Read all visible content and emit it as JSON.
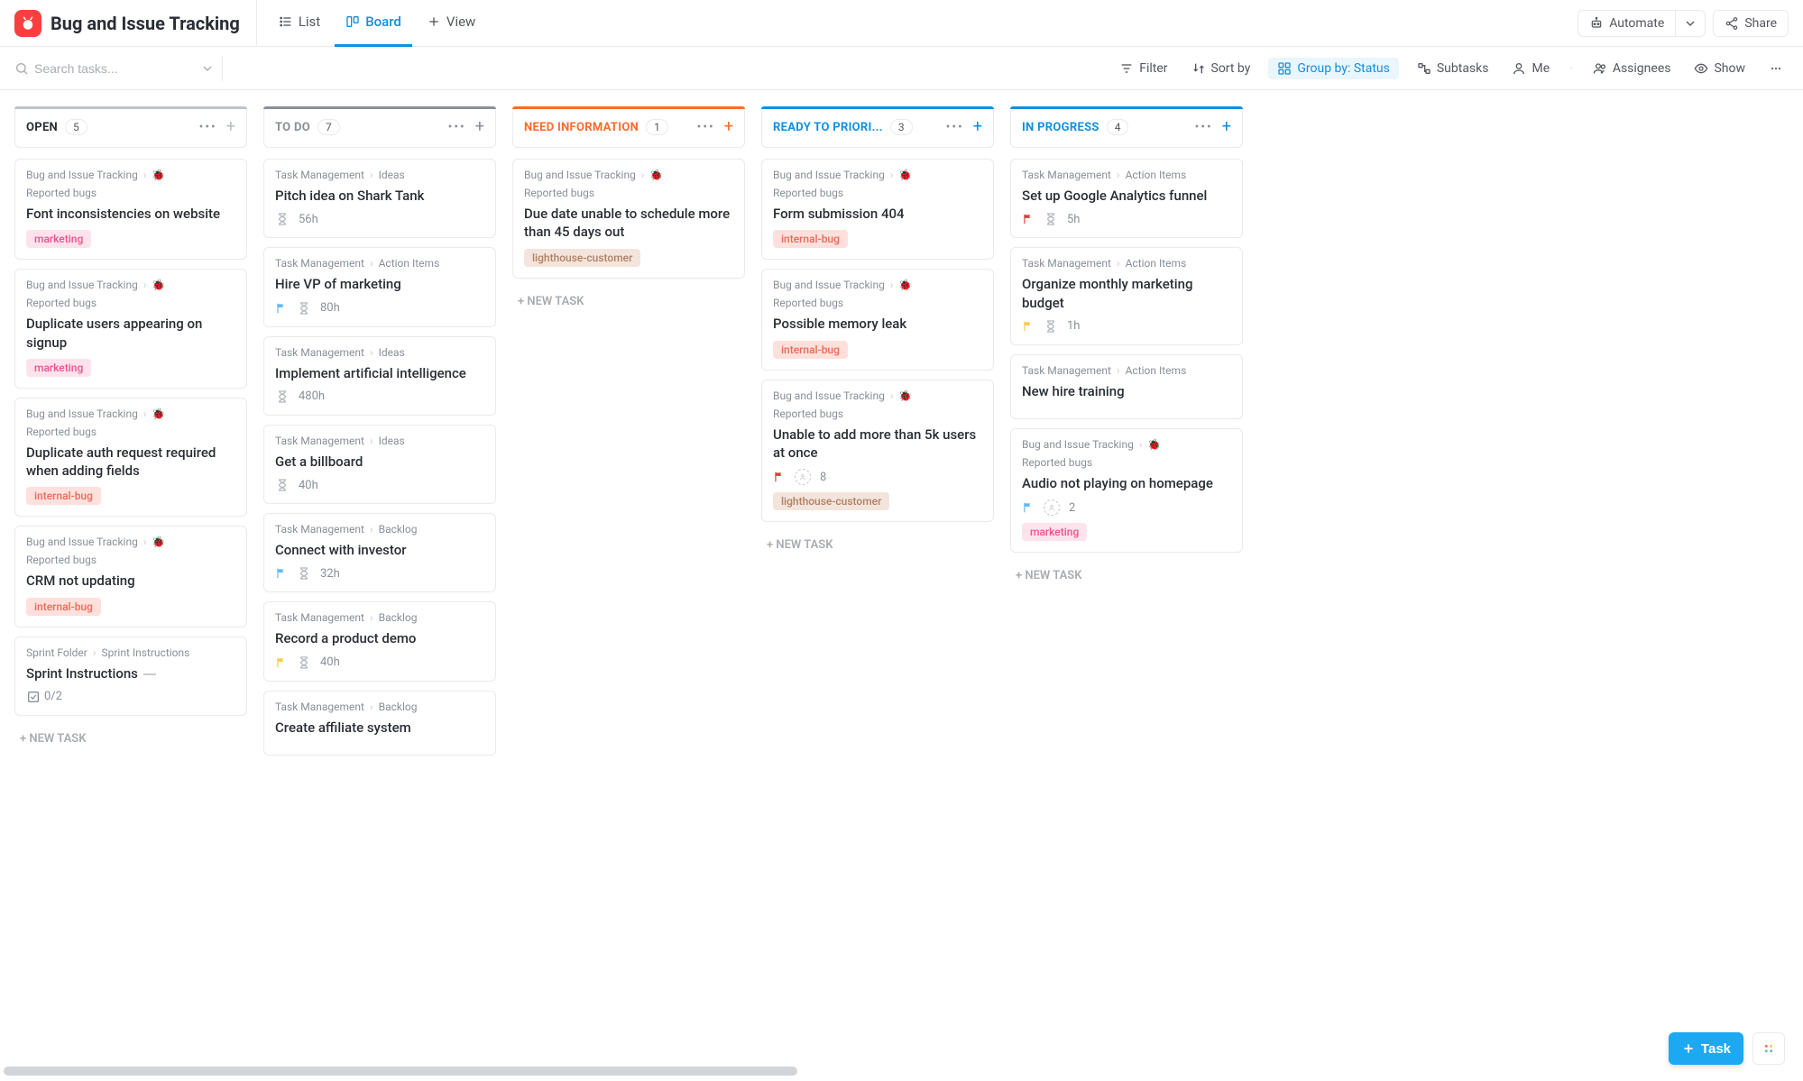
{
  "header": {
    "space_title": "Bug and Issue Tracking",
    "views": {
      "list": "List",
      "board": "Board",
      "add_view": "View"
    },
    "automate": "Automate",
    "share": "Share"
  },
  "toolbar": {
    "search_placeholder": "Search tasks...",
    "filter": "Filter",
    "sort_by": "Sort by",
    "group_by_label": "Group by: Status",
    "subtasks": "Subtasks",
    "me": "Me",
    "assignees": "Assignees",
    "show": "Show"
  },
  "new_task_label": "+ NEW TASK",
  "task_fab_label": "Task",
  "columns": [
    {
      "id": "open",
      "title": "OPEN",
      "count": 5,
      "accent": "#bfc3c9",
      "plus_color": "#b9bdc3",
      "cards": [
        {
          "crumb": [
            "Bug and Issue Tracking",
            "🐞Reported bugs"
          ],
          "title": "Font inconsistencies on website",
          "tags": [
            {
              "t": "marketing",
              "cls": "marketing"
            }
          ]
        },
        {
          "crumb": [
            "Bug and Issue Tracking",
            "🐞Reported bugs"
          ],
          "title": "Duplicate users appearing on signup",
          "tags": [
            {
              "t": "marketing",
              "cls": "marketing"
            }
          ]
        },
        {
          "crumb": [
            "Bug and Issue Tracking",
            "🐞Reported bugs"
          ],
          "title": "Duplicate auth request required when adding fields",
          "tags": [
            {
              "t": "internal-bug",
              "cls": "internal-bug"
            }
          ]
        },
        {
          "crumb": [
            "Bug and Issue Tracking",
            "🐞Reported bugs"
          ],
          "title": "CRM not updating",
          "tags": [
            {
              "t": "internal-bug",
              "cls": "internal-bug"
            }
          ]
        },
        {
          "crumb": [
            "Sprint Folder",
            "Sprint Instructions"
          ],
          "crumb_bug": false,
          "title": "Sprint Instructions",
          "title_suffix_bar": true,
          "checklist": "0/2"
        }
      ]
    },
    {
      "id": "todo",
      "title": "TO DO",
      "count": 7,
      "accent": "#8a8f98",
      "plus_color": "#8a8f98",
      "cards": [
        {
          "crumb": [
            "Task Management",
            "Ideas"
          ],
          "crumb_bug": false,
          "title": "Pitch idea on Shark Tank",
          "meta": [
            {
              "type": "time",
              "t": "56h"
            }
          ]
        },
        {
          "crumb": [
            "Task Management",
            "Action Items"
          ],
          "crumb_bug": false,
          "title": "Hire VP of marketing",
          "meta": [
            {
              "type": "flag",
              "color": "#62b6f1"
            },
            {
              "type": "time",
              "t": "80h"
            }
          ]
        },
        {
          "crumb": [
            "Task Management",
            "Ideas"
          ],
          "crumb_bug": false,
          "title": "Implement artificial intelligence",
          "meta": [
            {
              "type": "time",
              "t": "480h"
            }
          ]
        },
        {
          "crumb": [
            "Task Management",
            "Ideas"
          ],
          "crumb_bug": false,
          "title": "Get a billboard",
          "meta": [
            {
              "type": "time",
              "t": "40h"
            }
          ]
        },
        {
          "crumb": [
            "Task Management",
            "Backlog"
          ],
          "crumb_bug": false,
          "title": "Connect with investor",
          "meta": [
            {
              "type": "flag",
              "color": "#62b6f1"
            },
            {
              "type": "time",
              "t": "32h"
            }
          ]
        },
        {
          "crumb": [
            "Task Management",
            "Backlog"
          ],
          "crumb_bug": false,
          "title": "Record a product demo",
          "meta": [
            {
              "type": "flag",
              "color": "#f7c948"
            },
            {
              "type": "time",
              "t": "40h"
            }
          ]
        },
        {
          "crumb": [
            "Task Management",
            "Backlog"
          ],
          "crumb_bug": false,
          "title": "Create affiliate system",
          "truncated": true
        }
      ],
      "hide_new_task": true
    },
    {
      "id": "needinfo",
      "title": "NEED INFORMATION",
      "count": 1,
      "accent": "#fd6a2a",
      "plus_color": "#fd6a2a",
      "cards": [
        {
          "crumb": [
            "Bug and Issue Tracking",
            "🐞Reported bugs"
          ],
          "title": "Due date unable to schedule more than 45 days out",
          "tags": [
            {
              "t": "lighthouse-customer",
              "cls": "lighthouse"
            }
          ]
        }
      ]
    },
    {
      "id": "ready",
      "title": "READY TO PRIORI...",
      "count": 3,
      "accent": "#1090e0",
      "plus_color": "#1090e0",
      "cards": [
        {
          "crumb": [
            "Bug and Issue Tracking",
            "🐞Reported bugs"
          ],
          "title": "Form submission 404",
          "tags": [
            {
              "t": "internal-bug",
              "cls": "internal-bug"
            }
          ]
        },
        {
          "crumb": [
            "Bug and Issue Tracking",
            "🐞Reported bugs"
          ],
          "title": "Possible memory leak",
          "tags": [
            {
              "t": "internal-bug",
              "cls": "internal-bug"
            }
          ]
        },
        {
          "crumb": [
            "Bug and Issue Tracking",
            "🐞Reported bugs"
          ],
          "title": "Unable to add more than 5k users at once",
          "meta": [
            {
              "type": "flag",
              "color": "#e33b3b"
            },
            {
              "type": "avatar",
              "t": "8"
            }
          ],
          "tags": [
            {
              "t": "lighthouse-customer",
              "cls": "lighthouse"
            }
          ]
        }
      ]
    },
    {
      "id": "inprogress",
      "title": "IN PROGRESS",
      "count": 4,
      "accent": "#1090e0",
      "plus_color": "#1090e0",
      "cards": [
        {
          "crumb": [
            "Task Management",
            "Action Items"
          ],
          "crumb_bug": false,
          "title": "Set up Google Analytics funnel",
          "meta": [
            {
              "type": "flag",
              "color": "#e33b3b"
            },
            {
              "type": "time",
              "t": "5h"
            }
          ]
        },
        {
          "crumb": [
            "Task Management",
            "Action Items"
          ],
          "crumb_bug": false,
          "title": "Organize monthly marketing budget",
          "meta": [
            {
              "type": "flag",
              "color": "#f7c948"
            },
            {
              "type": "time",
              "t": "1h"
            }
          ]
        },
        {
          "crumb": [
            "Task Management",
            "Action Items"
          ],
          "crumb_bug": false,
          "title": "New hire training"
        },
        {
          "crumb": [
            "Bug and Issue Tracking",
            "🐞Reported bugs"
          ],
          "title": "Audio not playing on homepage",
          "meta": [
            {
              "type": "flag",
              "color": "#62b6f1"
            },
            {
              "type": "avatar",
              "t": "2"
            }
          ],
          "tags": [
            {
              "t": "marketing",
              "cls": "marketing"
            }
          ]
        }
      ]
    }
  ]
}
